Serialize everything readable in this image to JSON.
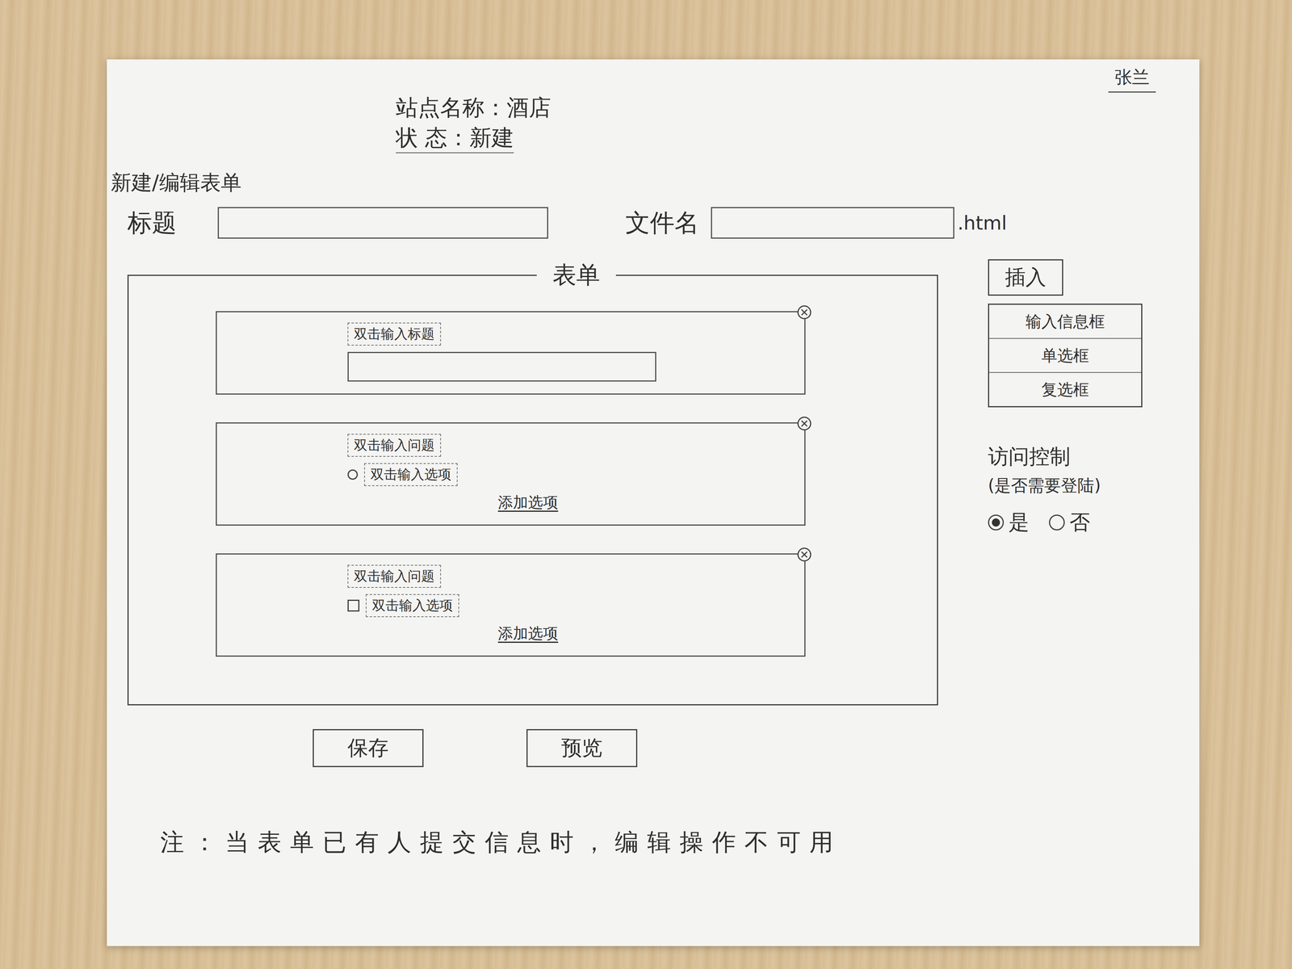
{
  "signature": "张兰",
  "header": {
    "site": "站点名称：酒店",
    "status": "状 态：新建"
  },
  "heading": "新建/编辑表单",
  "title_field": {
    "label": "标题",
    "value": ""
  },
  "file_field": {
    "label": "文件名",
    "value": "",
    "suffix": ".html"
  },
  "form": {
    "legend": "表单",
    "blocks": [
      {
        "kind": "text",
        "title": "双击输入标题",
        "value": ""
      },
      {
        "kind": "radio",
        "question": "双击输入问题",
        "options": [
          {
            "label": "双击输入选项",
            "selected": false
          }
        ],
        "add": "添加选项"
      },
      {
        "kind": "checkbox",
        "question": "双击输入问题",
        "options": [
          {
            "label": "双击输入选项",
            "checked": false
          }
        ],
        "add": "添加选项"
      }
    ]
  },
  "insert": {
    "button": "插入",
    "items": [
      "输入信息框",
      "单选框",
      "复选框"
    ]
  },
  "access": {
    "title": "访问控制",
    "hint": "(是否需要登陆)",
    "options": [
      {
        "label": "是",
        "selected": true
      },
      {
        "label": "否",
        "selected": false
      }
    ]
  },
  "buttons": [
    "保存",
    "预览"
  ],
  "note": "注：当表单已有人提交信息时，编辑操作不可用"
}
